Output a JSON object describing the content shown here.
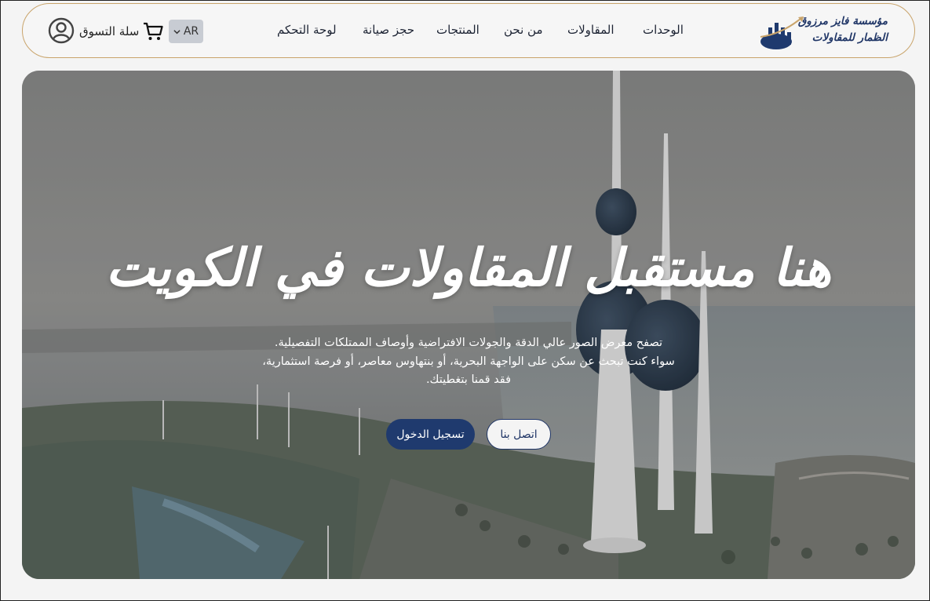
{
  "header": {
    "logo_line1": "مؤسسة فايز مرزوق",
    "logo_line2": "الظمار للمقاولات",
    "nav": [
      "الوحدات",
      "المقاولات",
      "من نحن",
      "المنتجات",
      "حجز صيانة",
      "لوحة التحكم"
    ],
    "lang": "AR",
    "cart_label": "سلة التسوق",
    "icons": {
      "cart": "cart-icon",
      "account": "user-circle-icon",
      "lang_caret": "chevron-down-icon"
    }
  },
  "hero": {
    "title": "هنا مستقبل المقاولات في الكويت",
    "desc": [
      "تصفح معرض الصور عالي الدقة والجولات الافتراضية وأوصاف الممتلكات التفصيلية.",
      "سواء كنت تبحث عن سكن على الواجهة البحرية، أو بنتهاوس معاصر، أو فرصة استثمارية،",
      "فقد قمنا بتغطيتك."
    ],
    "contact_button": "اتصل بنا",
    "login_button": "تسجيل الدخول"
  },
  "colors": {
    "brand": "#1f3a6e",
    "border_gold": "#c9a46b"
  }
}
